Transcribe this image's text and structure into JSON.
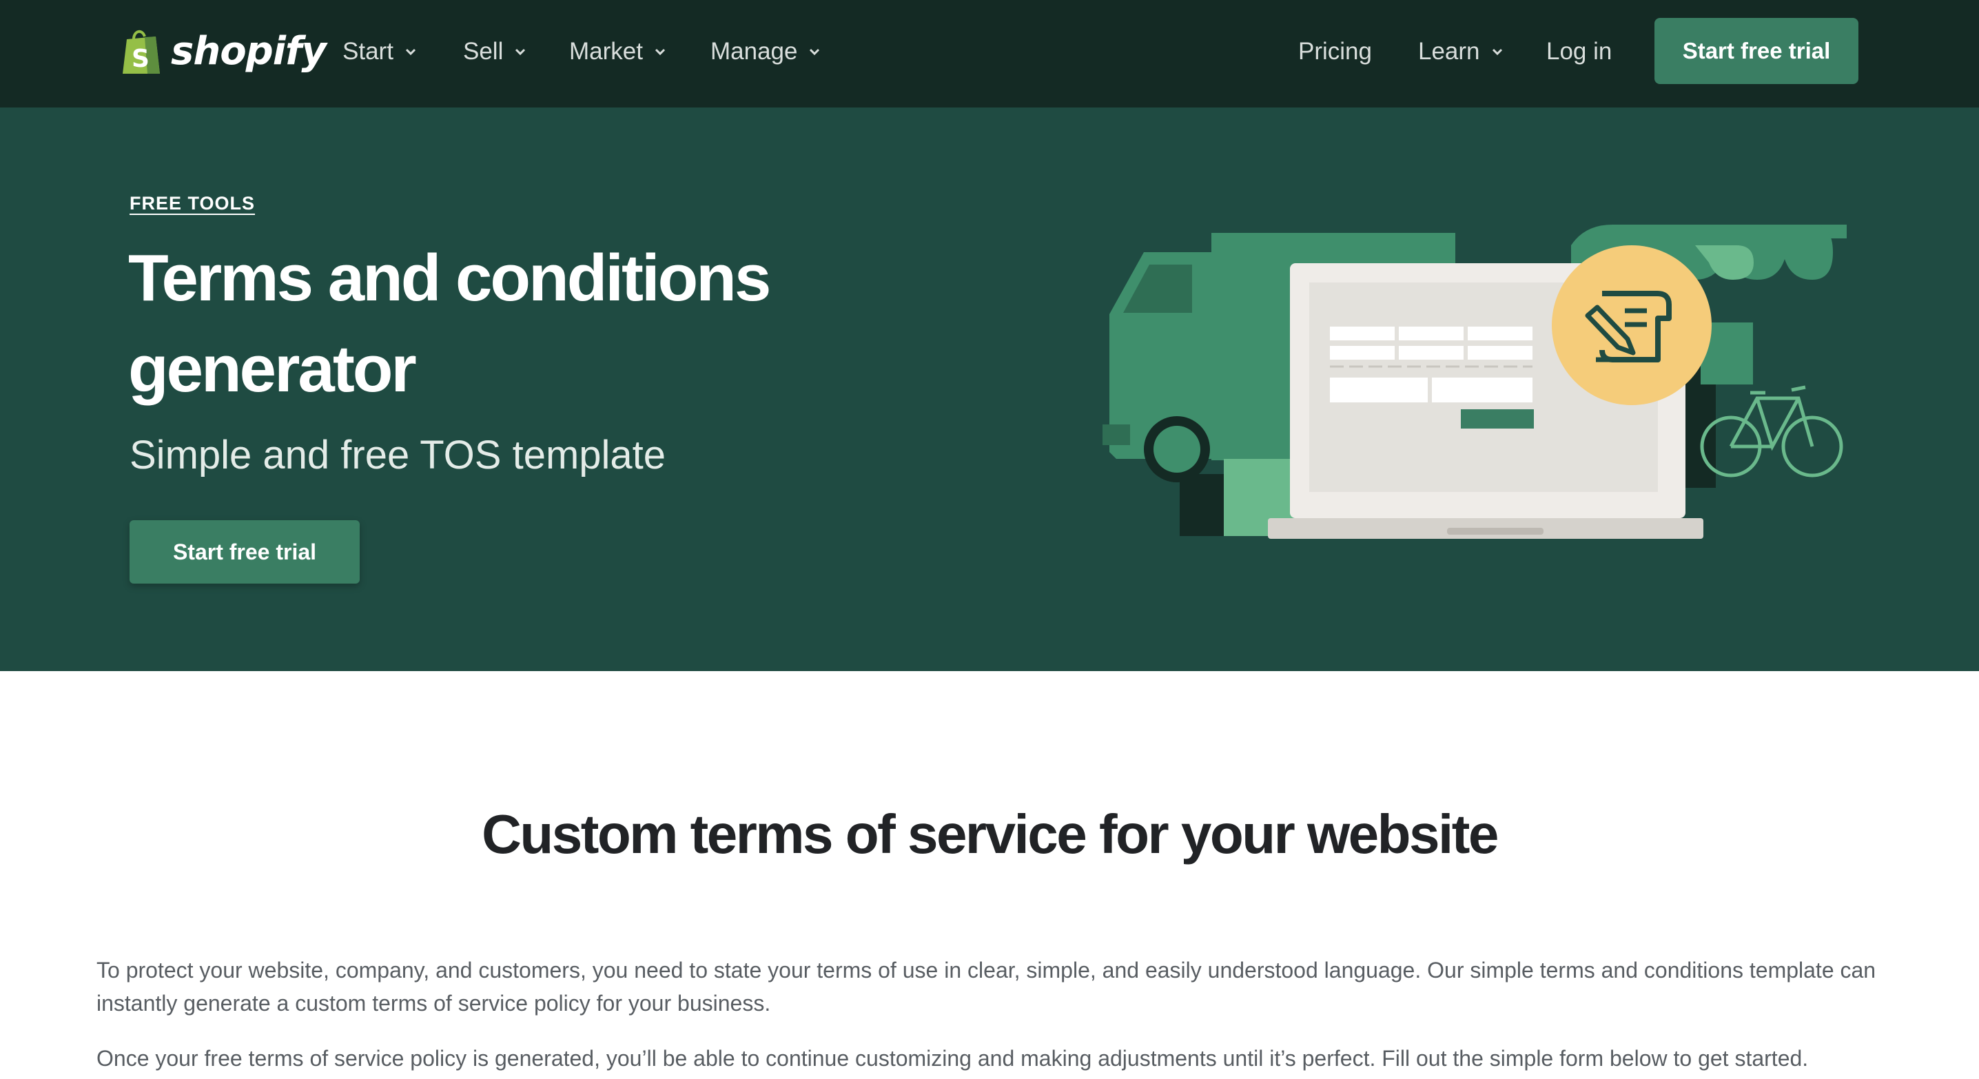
{
  "nav": {
    "logo_text": "shopify",
    "items": [
      {
        "label": "Start"
      },
      {
        "label": "Sell"
      },
      {
        "label": "Market"
      },
      {
        "label": "Manage"
      }
    ],
    "right": {
      "pricing": "Pricing",
      "learn": "Learn",
      "login": "Log in",
      "cta": "Start free trial"
    }
  },
  "hero": {
    "eyebrow": "FREE TOOLS",
    "title": "Terms and conditions generator",
    "subtitle": "Simple and free TOS template",
    "cta": "Start free trial"
  },
  "content": {
    "title": "Custom terms of service for your website",
    "paragraph1": "To protect your website, company, and customers, you need to state your terms of use in clear, simple, and easily understood language. Our simple terms and conditions template can instantly generate a custom terms of service policy for your business.",
    "paragraph2": "Once your free terms of service policy is generated, you’ll be able to continue customizing and making adjustments until it’s perfect. Fill out the simple form below to get started."
  },
  "colors": {
    "nav_bg": "#142a24",
    "hero_bg": "#1f4b42",
    "accent": "#3a7e63",
    "logo_bag": "#95bf47",
    "badge_yellow": "#f5cc7a"
  },
  "icons": [
    "shopify-bag-icon",
    "chevron-down-icon",
    "document-signature-icon",
    "truck-illustration",
    "laptop-illustration",
    "storefront-illustration",
    "bicycle-illustration"
  ]
}
